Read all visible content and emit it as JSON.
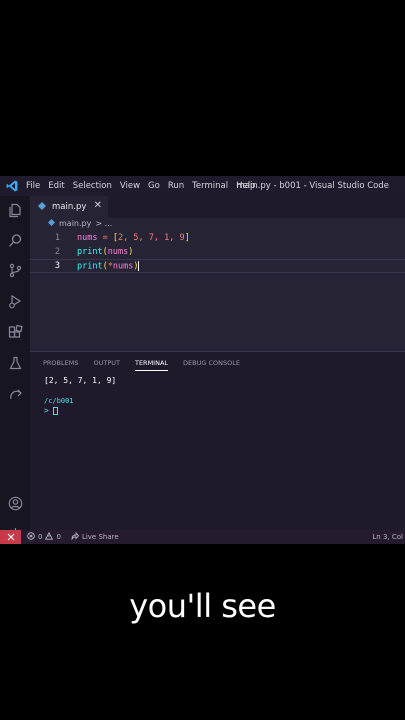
{
  "window": {
    "menu": [
      "File",
      "Edit",
      "Selection",
      "View",
      "Go",
      "Run",
      "Terminal",
      "Help"
    ],
    "title": "main.py - b001 - Visual Studio Code"
  },
  "activity_icons": [
    "explorer-icon",
    "search-icon",
    "source-control-icon",
    "run-debug-icon",
    "extensions-icon",
    "testing-icon",
    "remote-explorer-icon",
    "account-icon",
    "settings-gear-icon"
  ],
  "tab": {
    "label": "main.py",
    "close": "✕"
  },
  "breadcrumb": {
    "file": "main.py",
    "rest": "> ..."
  },
  "editor": {
    "lines": [
      {
        "num": "1",
        "tokens": [
          "nums",
          " = ",
          "[",
          "2",
          ", ",
          "5",
          ", ",
          "7",
          ", ",
          "1",
          ", ",
          "9",
          "]"
        ]
      },
      {
        "num": "2",
        "tokens": [
          "print",
          "(",
          "nums",
          ")"
        ]
      },
      {
        "num": "3",
        "tokens": [
          "print",
          "(",
          "*",
          "nums",
          ")"
        ]
      }
    ]
  },
  "panel": {
    "tabs": [
      "PROBLEMS",
      "OUTPUT",
      "TERMINAL",
      "DEBUG CONSOLE"
    ],
    "active_tab": "TERMINAL",
    "output": "[2, 5, 7, 1, 9]",
    "path": "/c/b001",
    "prompt": ">"
  },
  "status": {
    "errors": "0",
    "warnings": "0",
    "live_share": "Live Share",
    "position": "Ln 3, Col"
  },
  "caption": "you'll see",
  "colors": {
    "accent_remote": "#c8394a",
    "editor_bg": "#262335"
  }
}
